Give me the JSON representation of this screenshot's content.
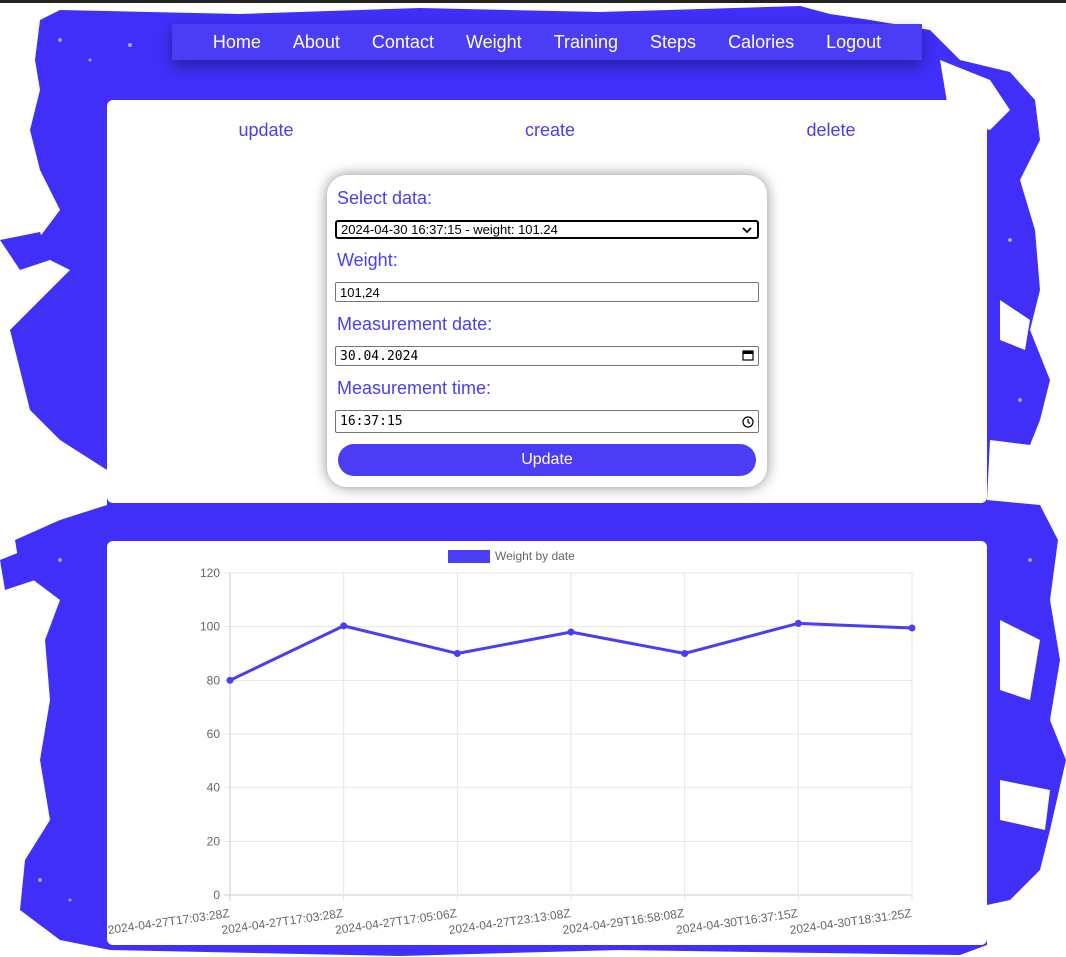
{
  "nav": {
    "items": [
      "Home",
      "About",
      "Contact",
      "Weight",
      "Training",
      "Steps",
      "Calories",
      "Logout"
    ]
  },
  "tabs": {
    "update": "update",
    "create": "create",
    "delete": "delete"
  },
  "form": {
    "select_label": "Select data:",
    "selected_option": "2024-04-30 16:37:15 - weight: 101.24",
    "weight_label": "Weight:",
    "weight_value": "101,24",
    "date_label": "Measurement date:",
    "date_value": "30.04.2024",
    "time_label": "Measurement time:",
    "time_value": "16:37:15",
    "submit_label": "Update"
  },
  "colors": {
    "accent": "#4b3cf5",
    "background_paint": "#3f2ff8",
    "white": "#ffffff"
  },
  "icons": {
    "date": "calendar-icon",
    "time": "clock-icon",
    "select": "chevron-down-icon"
  },
  "chart_data": {
    "type": "line",
    "legend": "Weight by date",
    "legend_position": "top",
    "categories": [
      "2024-04-27T17:03:28Z",
      "2024-04-27T17:03:28Z",
      "2024-04-27T17:05:06Z",
      "2024-04-27T23:13:08Z",
      "2024-04-29T16:58:08Z",
      "2024-04-30T16:37:15Z",
      "2024-04-30T18:31:25Z"
    ],
    "values": [
      80,
      100.3,
      90,
      98,
      90,
      101.24,
      99.5
    ],
    "ylim": [
      0,
      120
    ],
    "yticks": [
      0,
      20,
      40,
      60,
      80,
      100,
      120
    ],
    "grid": true,
    "color": "#4b3cf5"
  }
}
